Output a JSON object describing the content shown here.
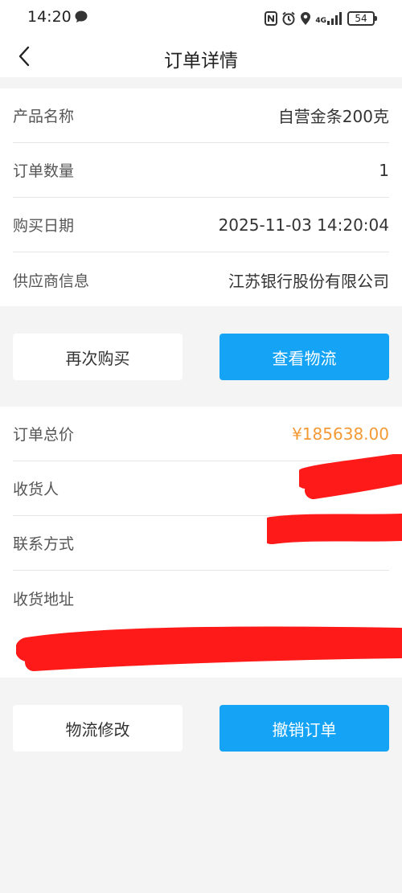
{
  "status_bar": {
    "time": "14:20",
    "network": "4G",
    "battery": "54"
  },
  "nav": {
    "title": "订单详情"
  },
  "product_info": [
    {
      "label": "产品名称",
      "value": "自营金条200克"
    },
    {
      "label": "订单数量",
      "value": "1"
    },
    {
      "label": "购买日期",
      "value": "2025-11-03 14:20:04"
    },
    {
      "label": "供应商信息",
      "value": "江苏银行股份有限公司"
    }
  ],
  "actions_top": {
    "rebuy_label": "再次购买",
    "logistics_label": "查看物流"
  },
  "delivery_info": {
    "total_label": "订单总价",
    "total_value": "¥185638.00",
    "receiver_label": "收货人",
    "contact_label": "联系方式",
    "address_label": "收货地址"
  },
  "actions_bottom": {
    "modify_label": "物流修改",
    "cancel_label": "撤销订单"
  },
  "colors": {
    "accent": "#14a3f5",
    "price": "#f39a36",
    "redaction": "#ff1a1a"
  }
}
